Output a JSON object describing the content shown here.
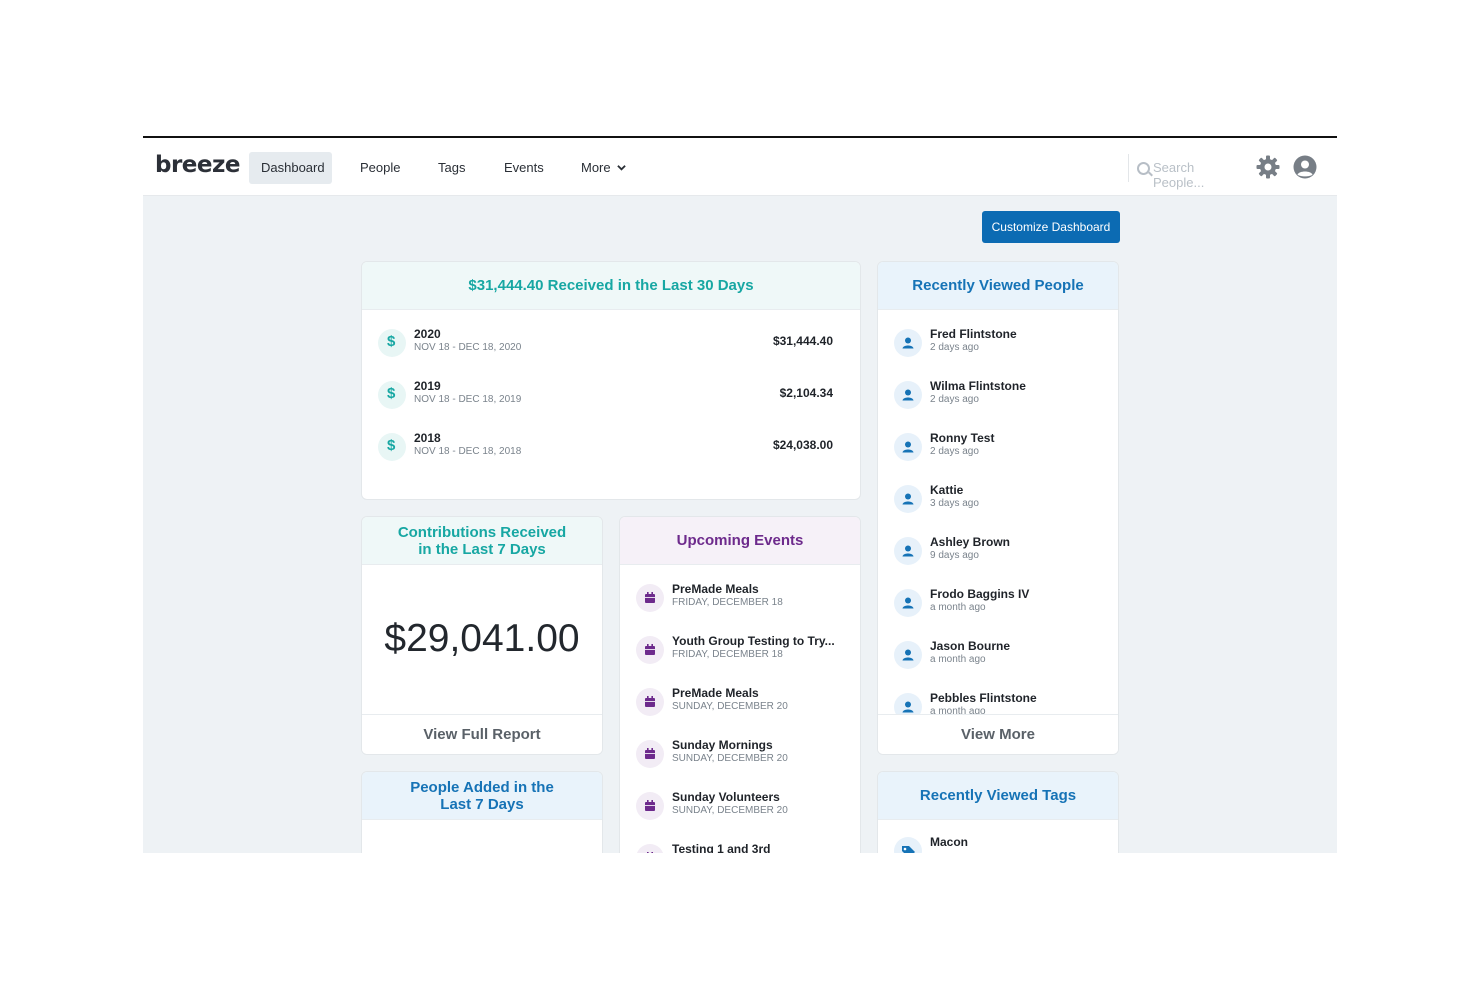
{
  "nav": {
    "logo": "breeze",
    "links": [
      "Dashboard",
      "People",
      "Tags",
      "Events",
      "More"
    ],
    "search_placeholder": "Search People..."
  },
  "customize_button": "Customize Dashboard",
  "received30": {
    "title": "$31,444.40 Received in the Last 30 Days",
    "rows": [
      {
        "year": "2020",
        "range": "NOV 18 - DEC 18, 2020",
        "amount": "$31,444.40"
      },
      {
        "year": "2019",
        "range": "NOV 18 - DEC 18, 2019",
        "amount": "$2,104.34"
      },
      {
        "year": "2018",
        "range": "NOV 18 - DEC 18, 2018",
        "amount": "$24,038.00"
      }
    ]
  },
  "contrib7": {
    "title_line1": "Contributions Received",
    "title_line2": "in the Last 7 Days",
    "amount": "$29,041.00",
    "footer": "View Full Report"
  },
  "events": {
    "title": "Upcoming Events",
    "items": [
      {
        "name": "PreMade Meals",
        "date": "FRIDAY, DECEMBER 18"
      },
      {
        "name": "Youth Group Testing to Try...",
        "date": "FRIDAY, DECEMBER 18"
      },
      {
        "name": "PreMade Meals",
        "date": "SUNDAY, DECEMBER 20"
      },
      {
        "name": "Sunday Mornings",
        "date": "SUNDAY, DECEMBER 20"
      },
      {
        "name": "Sunday Volunteers",
        "date": "SUNDAY, DECEMBER 20"
      },
      {
        "name": "Testing 1 and 3rd",
        "date": ""
      }
    ]
  },
  "people_added": {
    "title_line1": "People Added in the",
    "title_line2": "Last 7 Days"
  },
  "recent_people": {
    "title": "Recently Viewed People",
    "items": [
      {
        "name": "Fred Flintstone",
        "when": "2 days ago"
      },
      {
        "name": "Wilma Flintstone",
        "when": "2 days ago"
      },
      {
        "name": "Ronny Test",
        "when": "2 days ago"
      },
      {
        "name": "Kattie",
        "when": "3 days ago"
      },
      {
        "name": "Ashley Brown",
        "when": "9 days ago"
      },
      {
        "name": "Frodo Baggins IV",
        "when": "a month ago"
      },
      {
        "name": "Jason Bourne",
        "when": "a month ago"
      },
      {
        "name": "Pebbles Flintstone",
        "when": "a month ago"
      }
    ],
    "footer": "View More"
  },
  "recent_tags": {
    "title": "Recently Viewed Tags",
    "items": [
      {
        "name": "Macon"
      }
    ]
  },
  "colors": {
    "accent_blue": "#0c6bb3",
    "teal": "#17a7a3",
    "purple": "#6d2a8c"
  },
  "icons": {
    "money": "dollar-icon",
    "event": "calendar-icon",
    "person": "person-icon",
    "tag": "tag-icon",
    "settings": "gear-icon",
    "account": "user-circle-icon"
  }
}
